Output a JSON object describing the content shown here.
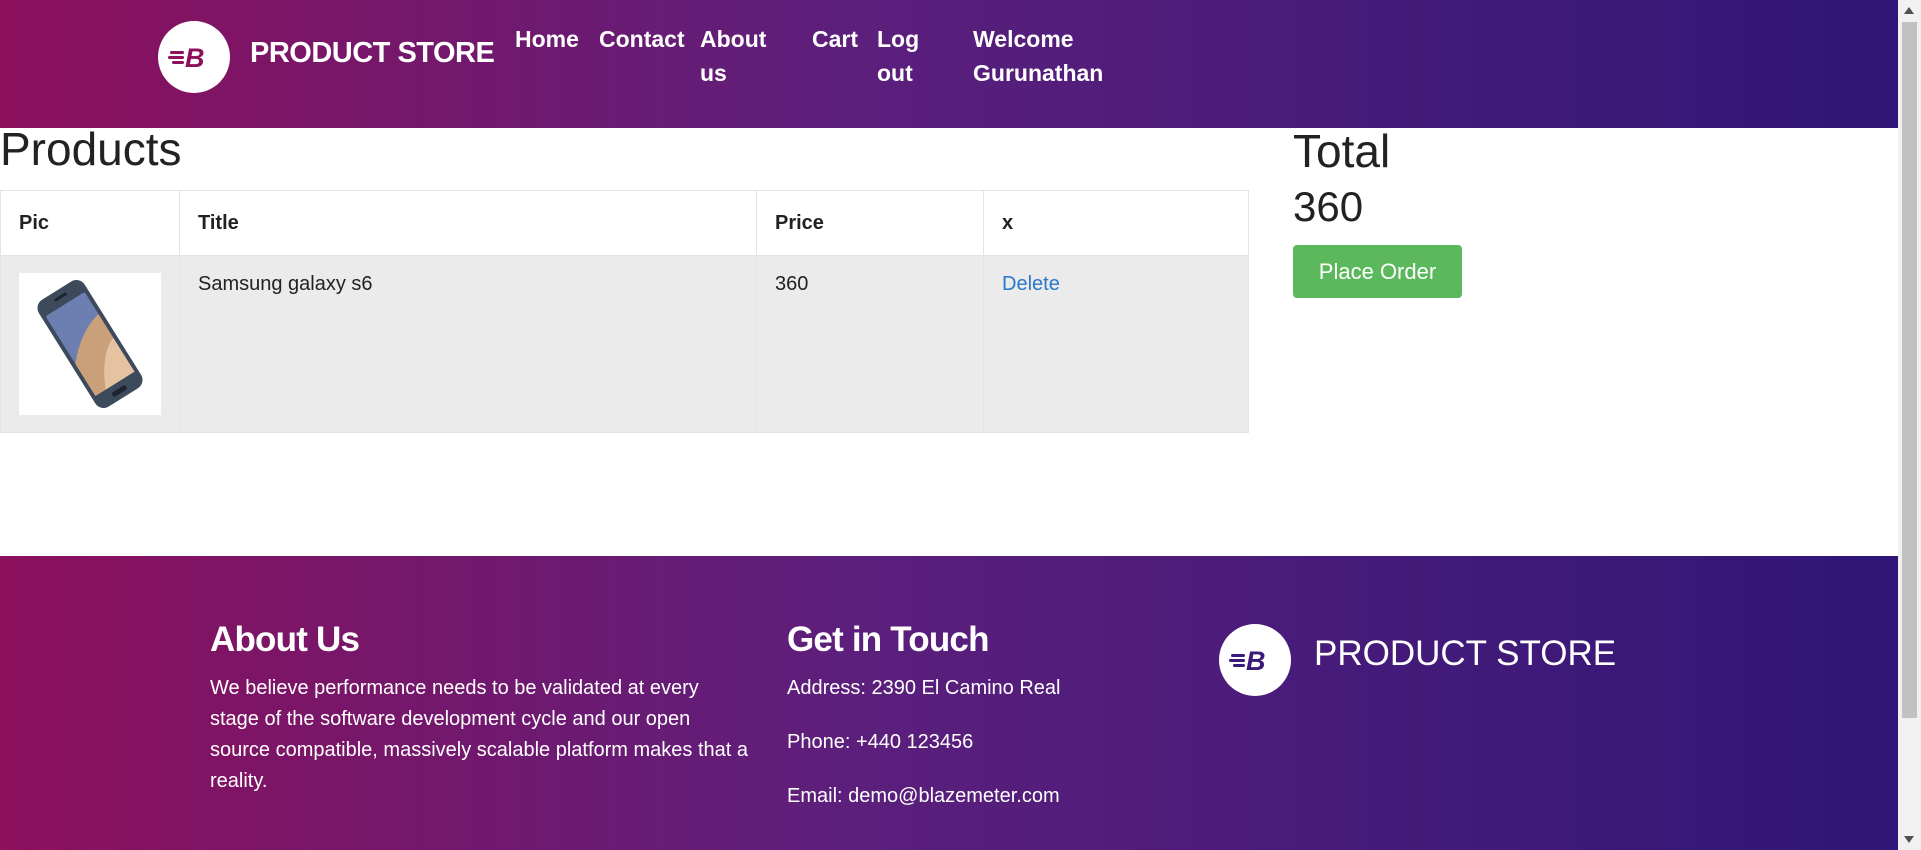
{
  "header": {
    "brand": "PRODUCT STORE",
    "nav": {
      "home": "Home",
      "contact": "Contact",
      "about": "About us",
      "cart": "Cart",
      "logout": "Log out",
      "welcome": "Welcome Gurunathan"
    }
  },
  "products": {
    "title": "Products",
    "columns": [
      "Pic",
      "Title",
      "Price",
      "x"
    ],
    "rows": [
      {
        "title": "Samsung galaxy s6",
        "price": "360",
        "action": "Delete"
      }
    ]
  },
  "total": {
    "label": "Total",
    "value": "360",
    "place_order": "Place Order"
  },
  "footer": {
    "about_title": "About Us",
    "about_text": "We believe performance needs to be validated at every stage of the software development cycle and our open source compatible, massively scalable platform makes that a reality.",
    "contact_title": "Get in Touch",
    "address": "Address: 2390 El Camino Real",
    "phone": "Phone: +440 123456",
    "email": "Email: demo@blazemeter.com",
    "brand": "PRODUCT STORE"
  },
  "colors": {
    "gradient_start": "#8c105c",
    "gradient_end": "#2f1677",
    "button": "#5cb85c",
    "link": "#2a77c9"
  },
  "icons": [
    "brand-logo-icon",
    "phone-product-image"
  ]
}
